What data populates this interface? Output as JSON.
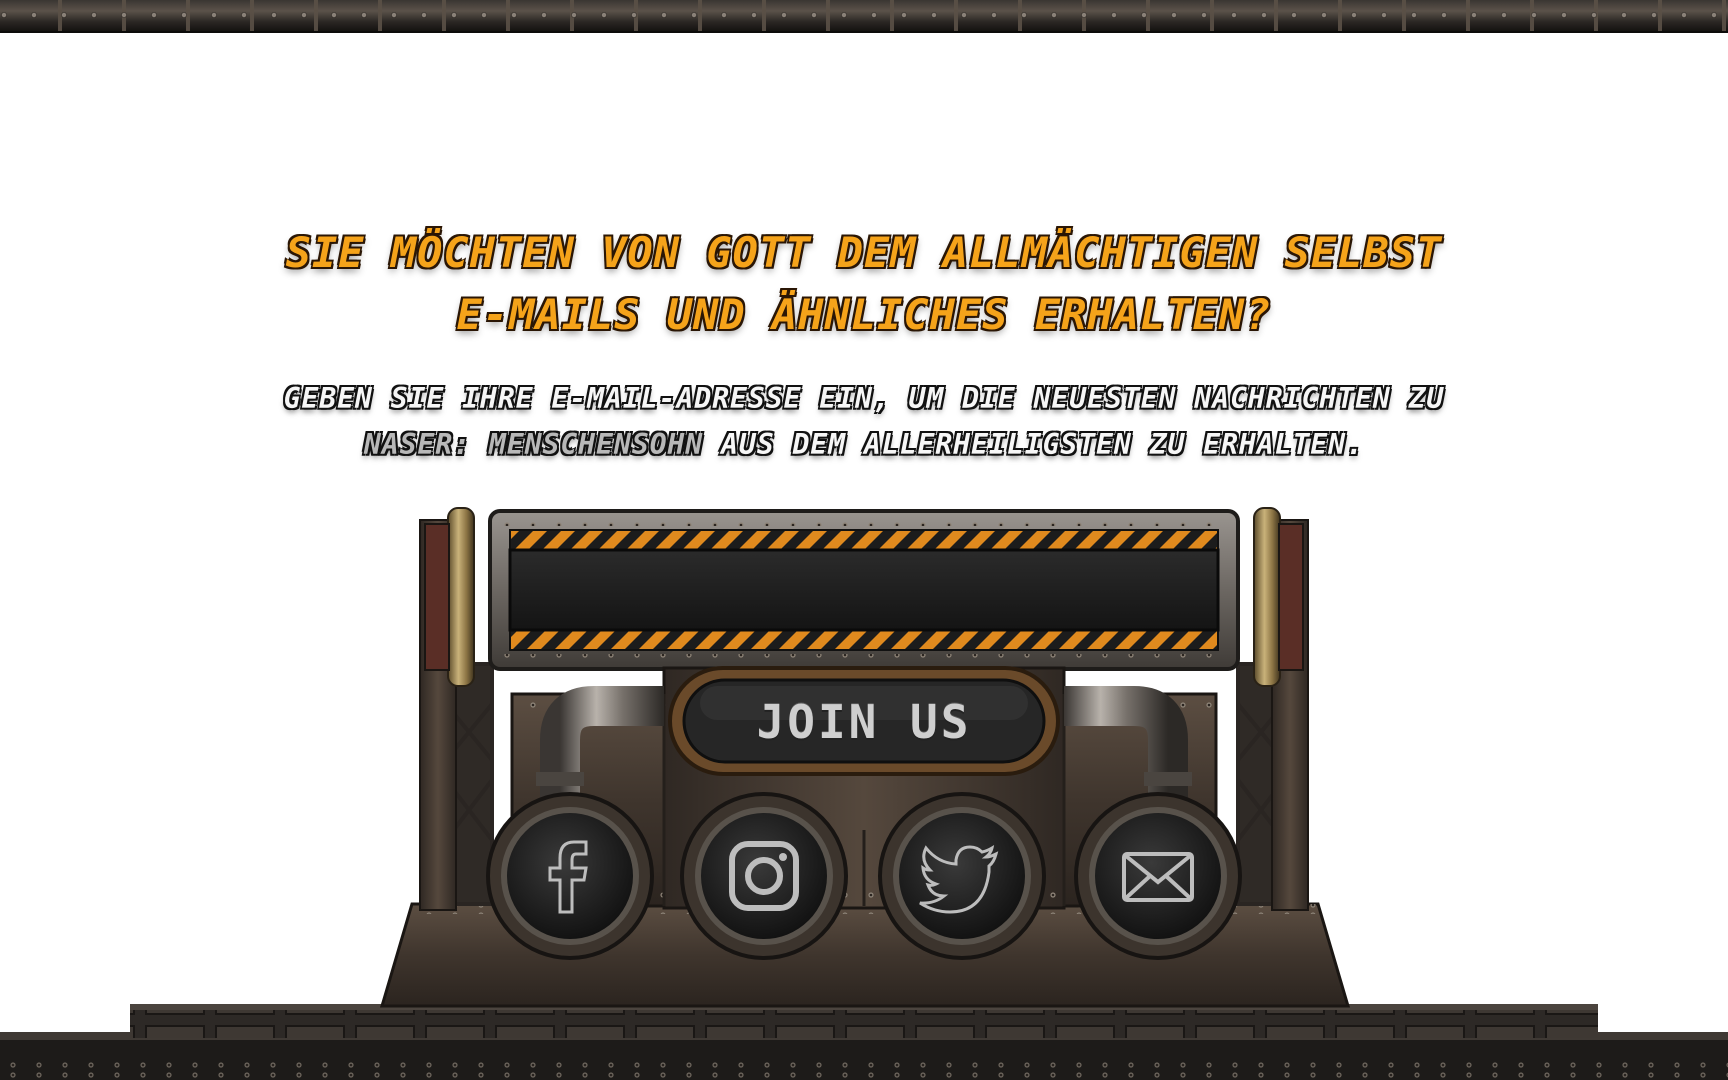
{
  "headline": {
    "line1": "SIE MÖCHTEN VON GOTT DEM ALLMÄCHTIGEN SELBST",
    "line2": "E-MAILS UND ÄHNLICHES ERHALTEN?"
  },
  "subline": {
    "line1": "GEBEN SIE IHRE E-MAIL-ADRESSE EIN, UM DIE NEUESTEN NACHRICHTEN ZU",
    "highlight": "NASER: MENSCHENSOHN",
    "line2_rest": " AUS DEM ALLERHEILIGSTEN ZU ERHALTEN."
  },
  "form": {
    "email_value": "",
    "email_placeholder": "",
    "join_label": "JOIN US"
  },
  "social": [
    {
      "name": "facebook",
      "icon": "facebook-icon"
    },
    {
      "name": "instagram",
      "icon": "instagram-icon"
    },
    {
      "name": "twitter",
      "icon": "twitter-icon"
    },
    {
      "name": "email",
      "icon": "mail-icon"
    }
  ],
  "colors": {
    "headline": "#f5a31a",
    "subline": "#f6f6f6",
    "highlight": "#b8b8b8",
    "hazard": "#e08a1e",
    "metal": "#4a3f36"
  }
}
